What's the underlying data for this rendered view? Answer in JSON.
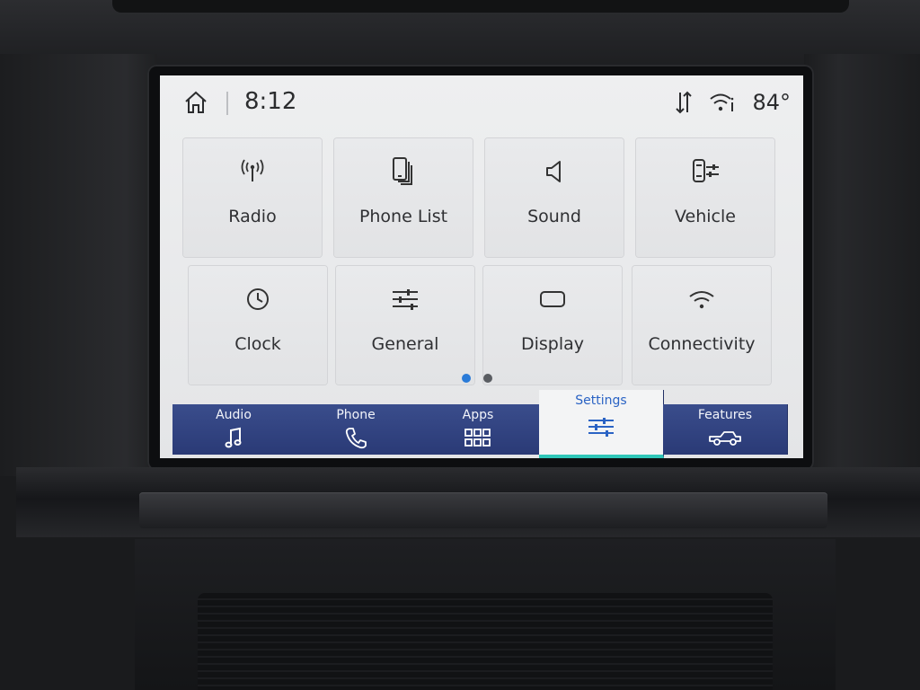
{
  "status": {
    "time": "8:12",
    "temperature": "84°",
    "icons": [
      "home-icon",
      "data-transfer-icon",
      "wifi-hotspot-icon"
    ]
  },
  "tiles": [
    {
      "label": "Radio",
      "icon": "radio-icon"
    },
    {
      "label": "Phone List",
      "icon": "phone-list-icon"
    },
    {
      "label": "Sound",
      "icon": "speaker-icon"
    },
    {
      "label": "Vehicle",
      "icon": "vehicle-settings-icon"
    },
    {
      "label": "Clock",
      "icon": "clock-icon"
    },
    {
      "label": "General",
      "icon": "sliders-icon"
    },
    {
      "label": "Display",
      "icon": "display-icon"
    },
    {
      "label": "Connectivity",
      "icon": "wifi-icon"
    }
  ],
  "pagination": {
    "pages": 2,
    "current": 1
  },
  "nav": [
    {
      "label": "Audio",
      "icon": "music-note-icon",
      "active": false
    },
    {
      "label": "Phone",
      "icon": "phone-icon",
      "active": false
    },
    {
      "label": "Apps",
      "icon": "apps-grid-icon",
      "active": false
    },
    {
      "label": "Settings",
      "icon": "sliders-icon",
      "active": true
    },
    {
      "label": "Features",
      "icon": "truck-icon",
      "active": false
    }
  ],
  "colors": {
    "nav_bg": "#2f4080",
    "active_label": "#2a63c4",
    "active_underline": "#2fc6b8",
    "dot_active": "#2a7bd8",
    "dot_inactive": "#5a5d62"
  }
}
